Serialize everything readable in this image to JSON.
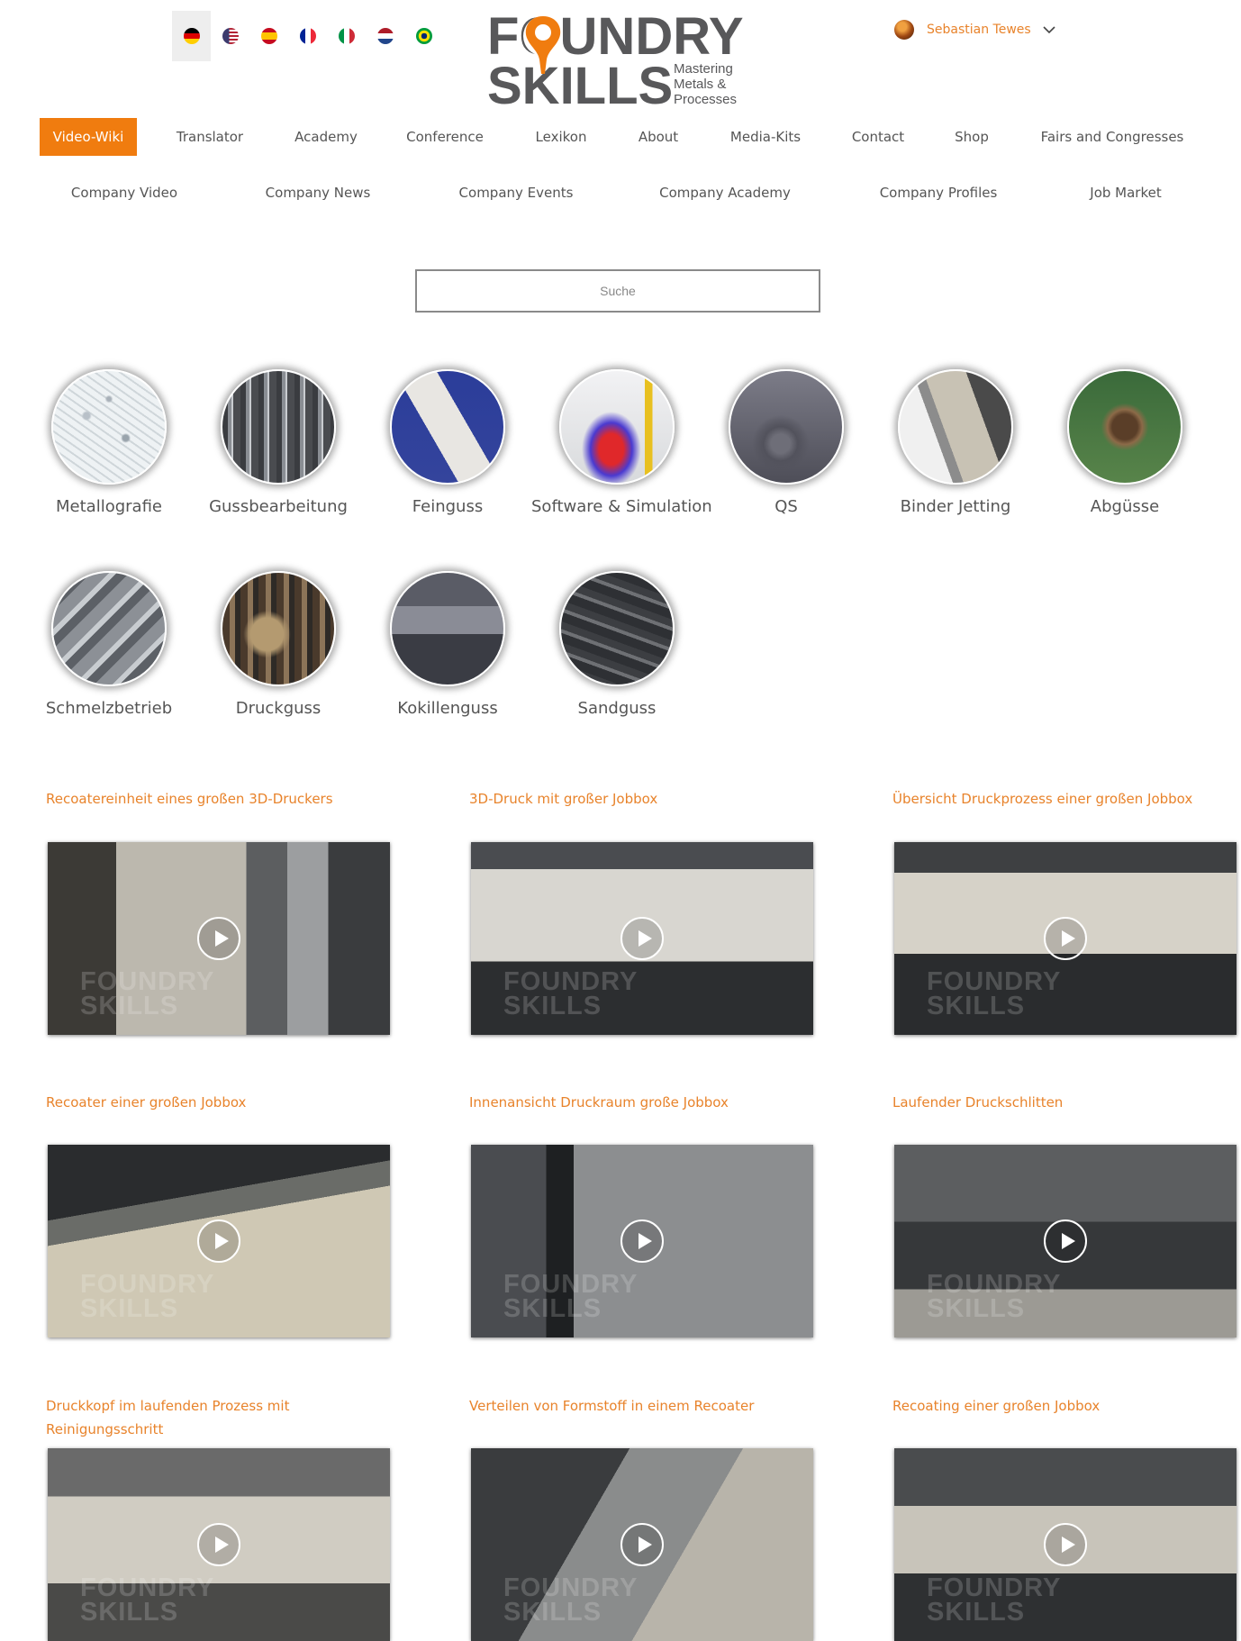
{
  "languages": [
    {
      "code": "de",
      "name": "Deutsch",
      "active": true
    },
    {
      "code": "us",
      "name": "English",
      "active": false
    },
    {
      "code": "es",
      "name": "Español",
      "active": false
    },
    {
      "code": "fr",
      "name": "Français",
      "active": false
    },
    {
      "code": "it",
      "name": "Italiano",
      "active": false
    },
    {
      "code": "nl",
      "name": "Nederlands",
      "active": false
    },
    {
      "code": "br",
      "name": "Português",
      "active": false
    }
  ],
  "logo": {
    "line1": "FOUNDRY",
    "line2": "SKILLS",
    "tagline": [
      "Mastering",
      "Metals &",
      "Processes"
    ]
  },
  "user": {
    "name": "Sebastian Tewes",
    "menu_icon": "chevron-down-icon"
  },
  "nav": {
    "items": [
      "Video-Wiki",
      "Translator",
      "Academy",
      "Conference",
      "Lexikon",
      "About",
      "Media-Kits",
      "Contact",
      "Shop",
      "Fairs and Congresses"
    ],
    "active": "Video-Wiki"
  },
  "subnav": {
    "items": [
      "Company Video",
      "Company News",
      "Company Events",
      "Company Academy",
      "Company Profiles",
      "Job Market"
    ]
  },
  "search": {
    "placeholder": "Suche"
  },
  "categories": [
    {
      "label": "Metallografie"
    },
    {
      "label": "Gussbearbeitung"
    },
    {
      "label": "Feinguss"
    },
    {
      "label": "Software & Simulation"
    },
    {
      "label": "QS"
    },
    {
      "label": "Binder Jetting"
    },
    {
      "label": "Abgüsse"
    },
    {
      "label": "Schmelzbetrieb"
    },
    {
      "label": "Druckguss"
    },
    {
      "label": "Kokillenguss"
    },
    {
      "label": "Sandguss"
    }
  ],
  "videos": [
    {
      "title": "Recoatereinheit eines großen 3D-Druckers"
    },
    {
      "title": "3D-Druck mit großer Jobbox"
    },
    {
      "title": "Übersicht Druckprozess einer großen Jobbox"
    },
    {
      "title": "Recoater einer großen Jobbox"
    },
    {
      "title": "Innenansicht Druckraum große Jobbox"
    },
    {
      "title": "Laufender Druckschlitten"
    },
    {
      "title": "Druckkopf im laufenden Prozess mit Reinigungsschritt"
    },
    {
      "title": "Verteilen von Formstoff in einem Recoater"
    },
    {
      "title": "Recoating einer großen Jobbox"
    }
  ],
  "colors": {
    "accent": "#f07c0f",
    "link": "#e8832b",
    "text": "#555555"
  }
}
